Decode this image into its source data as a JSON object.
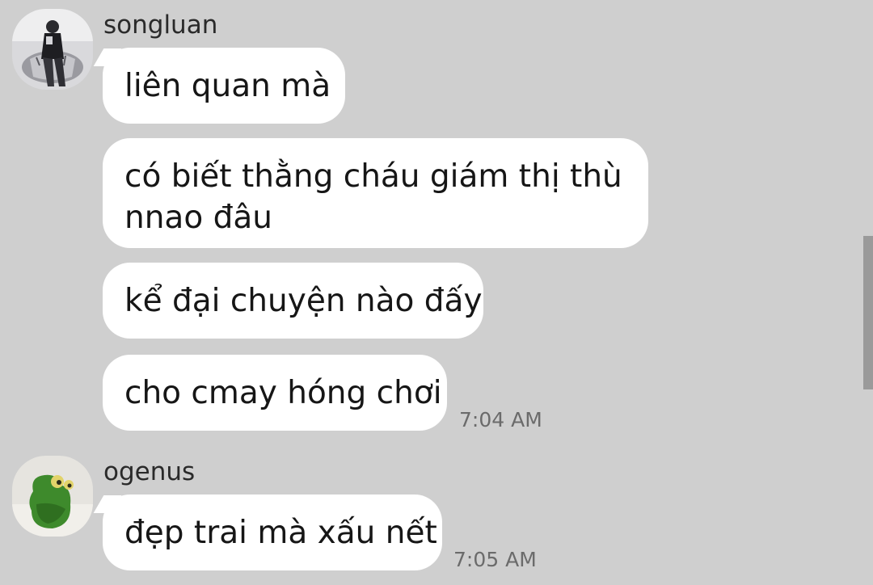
{
  "conversation": {
    "groups": [
      {
        "sender": "songluan",
        "avatar_icon": "user-photo-avatar",
        "messages": [
          "liên quan mà",
          "có biết thằng cháu giám thị thù nnao đâu",
          "kể đại chuyện nào đấy",
          "cho cmay hóng chơi"
        ],
        "time": "7:04 AM"
      },
      {
        "sender": "ogenus",
        "avatar_icon": "green-frog-avatar",
        "messages": [
          "đẹp trai mà xấu nết"
        ],
        "time": "7:05 AM"
      }
    ]
  },
  "colors": {
    "background": "#cfcfcf",
    "bubble": "#ffffff",
    "timestamp": "#6b6b6b"
  }
}
